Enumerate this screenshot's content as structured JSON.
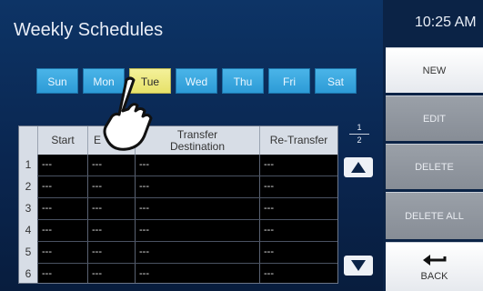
{
  "header": {
    "title": "Weekly Schedules",
    "time": "10:25 AM"
  },
  "days": [
    {
      "label": "Sun",
      "selected": false
    },
    {
      "label": "Mon",
      "selected": false
    },
    {
      "label": "Tue",
      "selected": true
    },
    {
      "label": "Wed",
      "selected": false
    },
    {
      "label": "Thu",
      "selected": false
    },
    {
      "label": "Fri",
      "selected": false
    },
    {
      "label": "Sat",
      "selected": false
    }
  ],
  "table": {
    "columns": [
      "",
      "Start",
      "E",
      "Transfer Destination",
      "Re-Transfer"
    ],
    "rows": [
      {
        "num": "1",
        "start": "---",
        "end": "---",
        "dest": "---",
        "retransfer": "---"
      },
      {
        "num": "2",
        "start": "---",
        "end": "---",
        "dest": "---",
        "retransfer": "---"
      },
      {
        "num": "3",
        "start": "---",
        "end": "---",
        "dest": "---",
        "retransfer": "---"
      },
      {
        "num": "4",
        "start": "---",
        "end": "---",
        "dest": "---",
        "retransfer": "---"
      },
      {
        "num": "5",
        "start": "---",
        "end": "---",
        "dest": "---",
        "retransfer": "---"
      },
      {
        "num": "6",
        "start": "---",
        "end": "---",
        "dest": "---",
        "retransfer": "---"
      }
    ]
  },
  "pager": {
    "current": "1",
    "total": "2"
  },
  "side_buttons": [
    {
      "label": "NEW",
      "enabled": true
    },
    {
      "label": "EDIT",
      "enabled": false
    },
    {
      "label": "DELETE",
      "enabled": false
    },
    {
      "label": "DELETE ALL",
      "enabled": false
    },
    {
      "label": "BACK",
      "enabled": true
    }
  ],
  "icons": {
    "scroll_up": "triangle-up-icon",
    "scroll_down": "triangle-down-icon",
    "back": "return-arrow-icon",
    "pointer": "pointing-hand-icon"
  },
  "colors": {
    "background": "#0d3466",
    "day_button": "#3aa8e0",
    "day_selected": "#eee97f",
    "side_disabled": "#8f959e"
  }
}
